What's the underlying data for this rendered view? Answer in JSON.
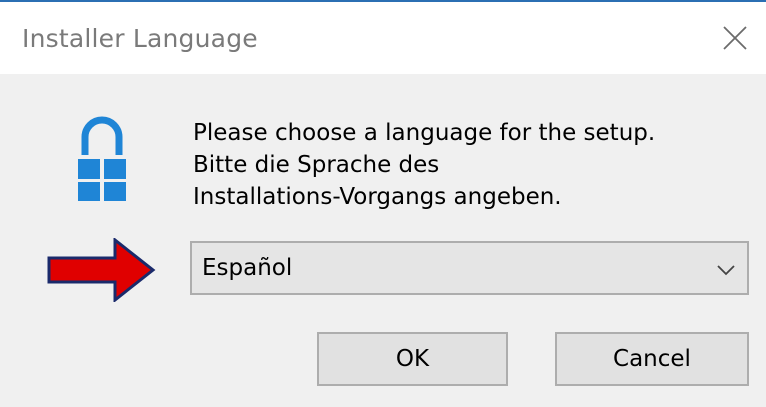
{
  "window": {
    "title": "Installer Language",
    "close_icon": "close-icon"
  },
  "dialog": {
    "icon": "lock-icon",
    "message_lines": [
      "Please choose a language for the setup.",
      "Bitte die Sprache des",
      "Installations-Vorgangs angeben."
    ],
    "language_select": {
      "selected": "Español",
      "chevron_icon": "chevron-down-icon"
    },
    "annotation_arrow": {
      "icon": "red-arrow-icon",
      "color": "#e00000"
    },
    "buttons": {
      "ok": "OK",
      "cancel": "Cancel"
    }
  },
  "colors": {
    "titlebar_bg": "#ffffff",
    "dialog_bg": "#f0f0f0",
    "accent_border": "#2b6fb3",
    "lock_blue": "#1f85d6",
    "arrow_red": "#e00000"
  }
}
